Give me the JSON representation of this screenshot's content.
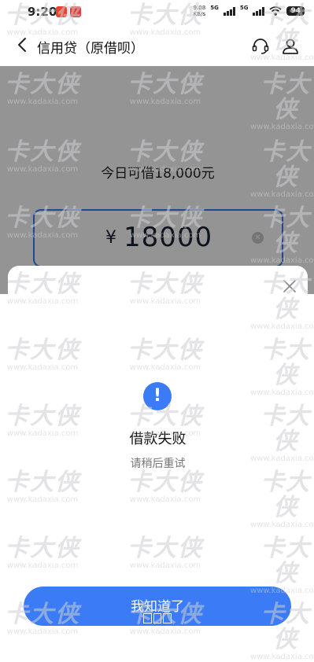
{
  "status_bar": {
    "time": "9:20",
    "net_speed_value": "9.08",
    "net_speed_unit": "KB/s",
    "network_1": "5G",
    "network_2": "5G",
    "battery": "94"
  },
  "nav": {
    "title": "信用贷（原借呗）"
  },
  "loan": {
    "available_text": "今日可借18,000元",
    "currency": "¥",
    "amount": "18000"
  },
  "dialog": {
    "title": "借款失败",
    "subtitle": "请稍后重试",
    "button_label": "我知道了"
  },
  "watermark": {
    "logo_text": "卡大侠",
    "url": "www.kadaxia.com"
  },
  "colors": {
    "accent": "#3b7cf6",
    "overlay": "rgba(0,0,0,0.42)",
    "notif_red_1": "#e8412c",
    "notif_red_2": "#e53935"
  },
  "icons": [
    "back-icon",
    "customer-service-icon",
    "user-icon",
    "clear-icon",
    "close-icon",
    "alert-icon",
    "signal-icon",
    "wifi-icon",
    "battery-icon"
  ]
}
